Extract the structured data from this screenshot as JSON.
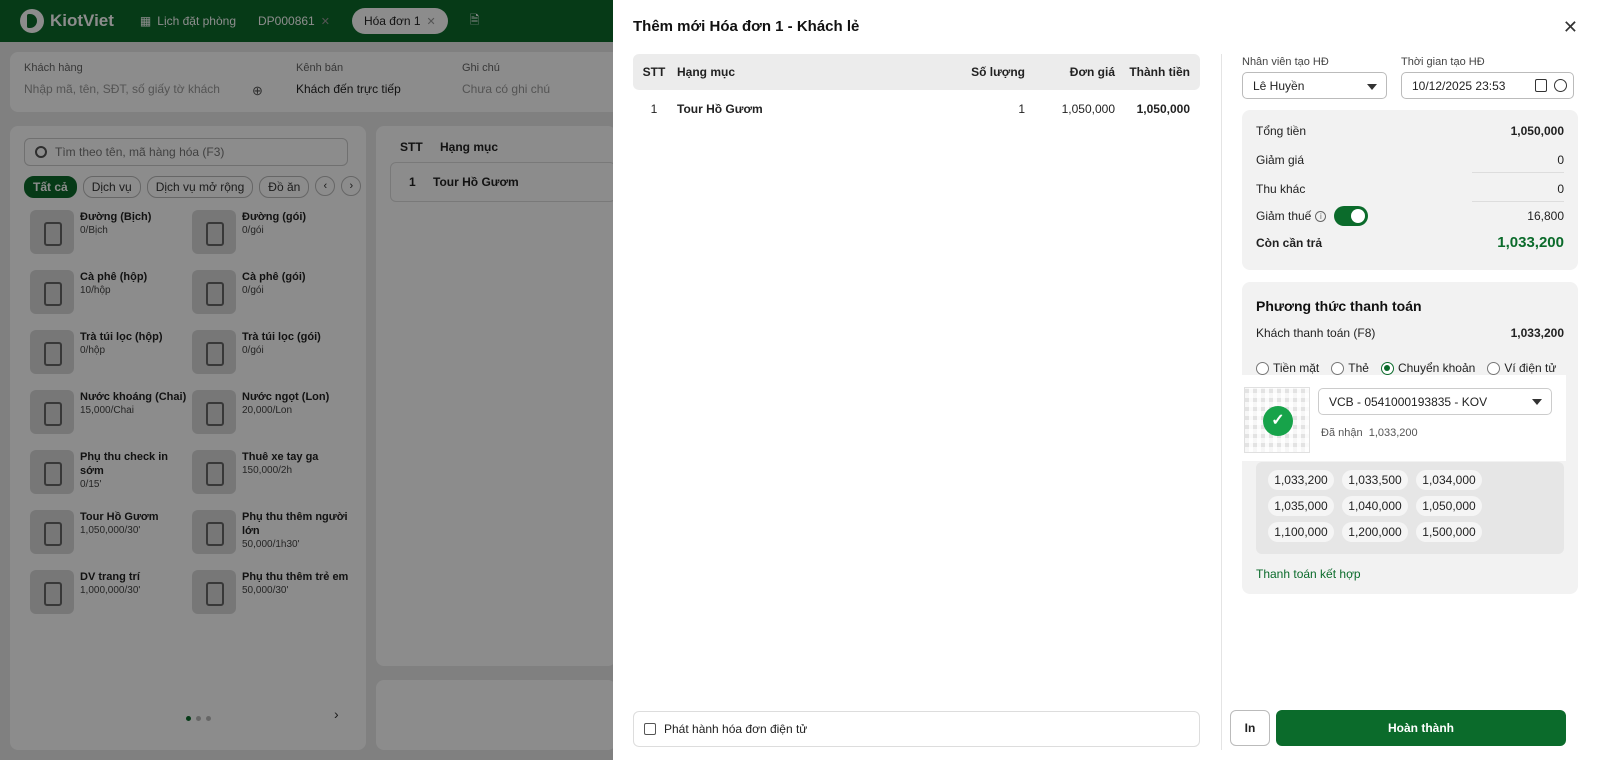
{
  "app": {
    "logo_text": "KiotViet",
    "tabs": [
      {
        "label": "Lịch đặt phòng"
      },
      {
        "label": "DP000861"
      },
      {
        "label": "Hóa đơn 1"
      }
    ]
  },
  "background": {
    "customer_label": "Khách hàng",
    "customer_placeholder": "Nhập mã, tên, SĐT, số giấy tờ khách",
    "channel_label": "Kênh bán",
    "channel_value": "Khách đến trực tiếp",
    "note_label": "Ghi chú",
    "note_placeholder": "Chưa có ghi chú",
    "search_placeholder": "Tìm theo tên, mã hàng hóa (F3)",
    "categories": [
      "Tất cả",
      "Dịch vụ",
      "Dịch vụ mở rộng",
      "Đồ ăn"
    ],
    "products": [
      {
        "name": "Đường (Bịch)",
        "price": "0/Bịch"
      },
      {
        "name": "Đường (gói)",
        "price": "0/gói"
      },
      {
        "name": "Cà phê (hộp)",
        "price": "10/hộp"
      },
      {
        "name": "Cà phê (gói)",
        "price": "0/gói"
      },
      {
        "name": "Trà túi lọc (hộp)",
        "price": "0/hộp"
      },
      {
        "name": "Trà túi lọc (gói)",
        "price": "0/gói"
      },
      {
        "name": "Nước khoáng (Chai)",
        "price": "15,000/Chai"
      },
      {
        "name": "Nước ngọt (Lon)",
        "price": "20,000/Lon"
      },
      {
        "name": "Phụ thu check in sớm",
        "price": "0/15'"
      },
      {
        "name": "Thuê xe tay ga",
        "price": "150,000/2h"
      },
      {
        "name": "Tour Hồ Gươm",
        "price": "1,050,000/30'"
      },
      {
        "name": "Phụ thu thêm người lớn",
        "price": "50,000/1h30'"
      },
      {
        "name": "DV trang trí",
        "price": "1,000,000/30'"
      },
      {
        "name": "Phụ thu thêm trẻ em",
        "price": "50,000/30'"
      }
    ],
    "order_headers": {
      "stt": "STT",
      "name": "Hạng mục"
    },
    "order_row": {
      "stt": "1",
      "name": "Tour Hồ Gươm"
    }
  },
  "modal": {
    "title": "Thêm mới Hóa đơn 1 - Khách lẻ",
    "table": {
      "headers": {
        "stt": "STT",
        "item": "Hạng mục",
        "qty": "Số lượng",
        "price": "Đơn giá",
        "total": "Thành tiền"
      },
      "rows": [
        {
          "stt": "1",
          "item": "Tour Hồ Gươm",
          "qty": "1",
          "price": "1,050,000",
          "total": "1,050,000"
        }
      ]
    },
    "einvoice_label": "Phát hành hóa đơn điện tử",
    "staff_label": "Nhân viên tạo HĐ",
    "staff_value": "Lê Huyền",
    "time_label": "Thời gian tạo HĐ",
    "time_value": "10/12/2025 23:53",
    "summary": {
      "total_label": "Tổng tiền",
      "total_value": "1,050,000",
      "discount_label": "Giảm giá",
      "discount_value": "0",
      "other_label": "Thu khác",
      "other_value": "0",
      "tax_label": "Giảm thuế",
      "tax_value": "16,800",
      "due_label": "Còn cần trả",
      "due_value": "1,033,200"
    },
    "payment": {
      "title": "Phương thức thanh toán",
      "customer_pay_label": "Khách thanh toán (F8)",
      "customer_pay_value": "1,033,200",
      "methods": [
        "Tiền mặt",
        "Thẻ",
        "Chuyển khoản",
        "Ví điện tử"
      ],
      "selected_method": "Chuyển khoản",
      "bank_account": "VCB - 0541000193835 - KOV",
      "received_label": "Đã nhận",
      "received_value": "1,033,200",
      "quick_amounts": [
        "1,033,200",
        "1,033,500",
        "1,034,000",
        "1,035,000",
        "1,040,000",
        "1,050,000",
        "1,100,000",
        "1,200,000",
        "1,500,000"
      ],
      "combined_label": "Thanh toán kết hợp"
    },
    "print_label": "In",
    "done_label": "Hoàn thành"
  },
  "colors": {
    "brand_green": "#0b6b2b",
    "success_green": "#17a34a"
  }
}
